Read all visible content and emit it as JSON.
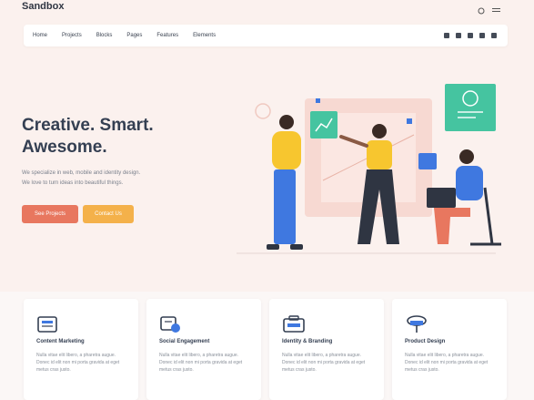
{
  "brand": "Sandbox",
  "nav": {
    "items": [
      "Home",
      "Projects",
      "Blocks",
      "Pages",
      "Features",
      "Elements"
    ]
  },
  "hero": {
    "title_line1": "Creative. Smart.",
    "title_line2": "Awesome.",
    "desc_line1": "We specialize in web, mobile and identity design.",
    "desc_line2": "We love to turn ideas into beautiful things.",
    "btn_primary": "See Projects",
    "btn_secondary": "Contact Us"
  },
  "services": [
    {
      "title": "Content Marketing",
      "icon": "content-icon",
      "desc": "Nulla vitae elit libero, a pharetra augue. Donec id elit non mi porta gravida at eget metus cras justo."
    },
    {
      "title": "Social Engagement",
      "icon": "social-icon",
      "desc": "Nulla vitae elit libero, a pharetra augue. Donec id elit non mi porta gravida at eget metus cras justo."
    },
    {
      "title": "Identity & Branding",
      "icon": "identity-icon",
      "desc": "Nulla vitae elit libero, a pharetra augue. Donec id elit non mi porta gravida at eget metus cras justo."
    },
    {
      "title": "Product Design",
      "icon": "product-icon",
      "desc": "Nulla vitae elit libero, a pharetra augue. Donec id elit non mi porta gravida at eget metus cras justo."
    }
  ],
  "colors": {
    "bg": "#fbf1ee",
    "primary": "#e8775f",
    "secondary": "#f4b14a",
    "green": "#45c4a0",
    "blue": "#3f78e0"
  }
}
